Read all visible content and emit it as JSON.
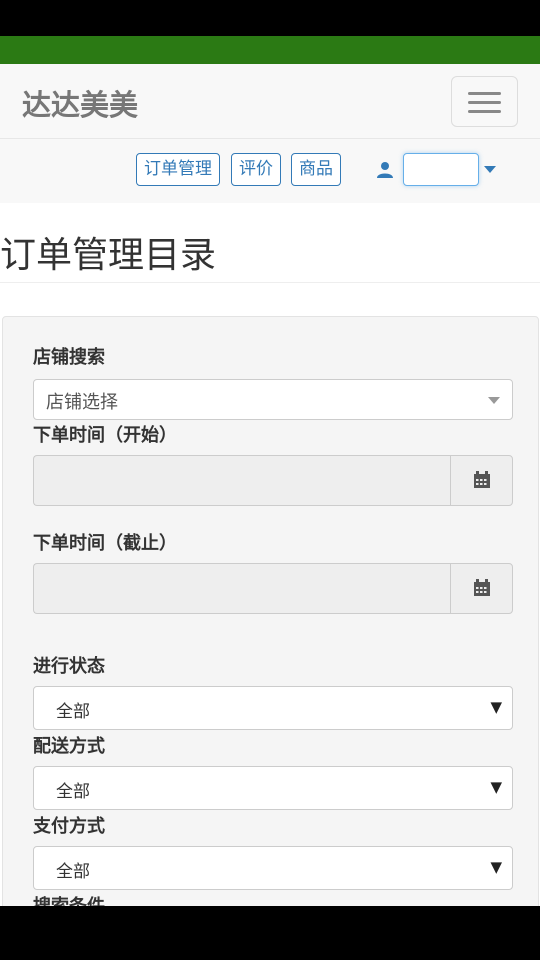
{
  "app": {
    "brand": "达达美美"
  },
  "nav": {
    "links": [
      {
        "label": "订单管理"
      },
      {
        "label": "评价"
      },
      {
        "label": "商品"
      }
    ],
    "user_dropdown": {
      "value": ""
    }
  },
  "page": {
    "title": "订单管理目录"
  },
  "form": {
    "store_search": {
      "label": "店铺搜索",
      "placeholder": "店铺选择"
    },
    "order_time_start": {
      "label": "下单时间（开始）",
      "value": ""
    },
    "order_time_end": {
      "label": "下单时间（截止）",
      "value": ""
    },
    "progress_status": {
      "label": "进行状态",
      "selected": "全部"
    },
    "delivery_method": {
      "label": "配送方式",
      "selected": "全部"
    },
    "payment_method": {
      "label": "支付方式",
      "selected": "全部"
    },
    "search_conditions": {
      "label": "搜索条件"
    }
  },
  "colors": {
    "status_bar_green": "#2b7a14",
    "link_blue": "#337ab7",
    "navbar_bg": "#f8f8f8",
    "panel_bg": "#f5f5f5"
  },
  "icons": [
    "menu-icon",
    "user-icon",
    "caret-down-icon",
    "calendar-icon",
    "select-arrow-icon"
  ]
}
